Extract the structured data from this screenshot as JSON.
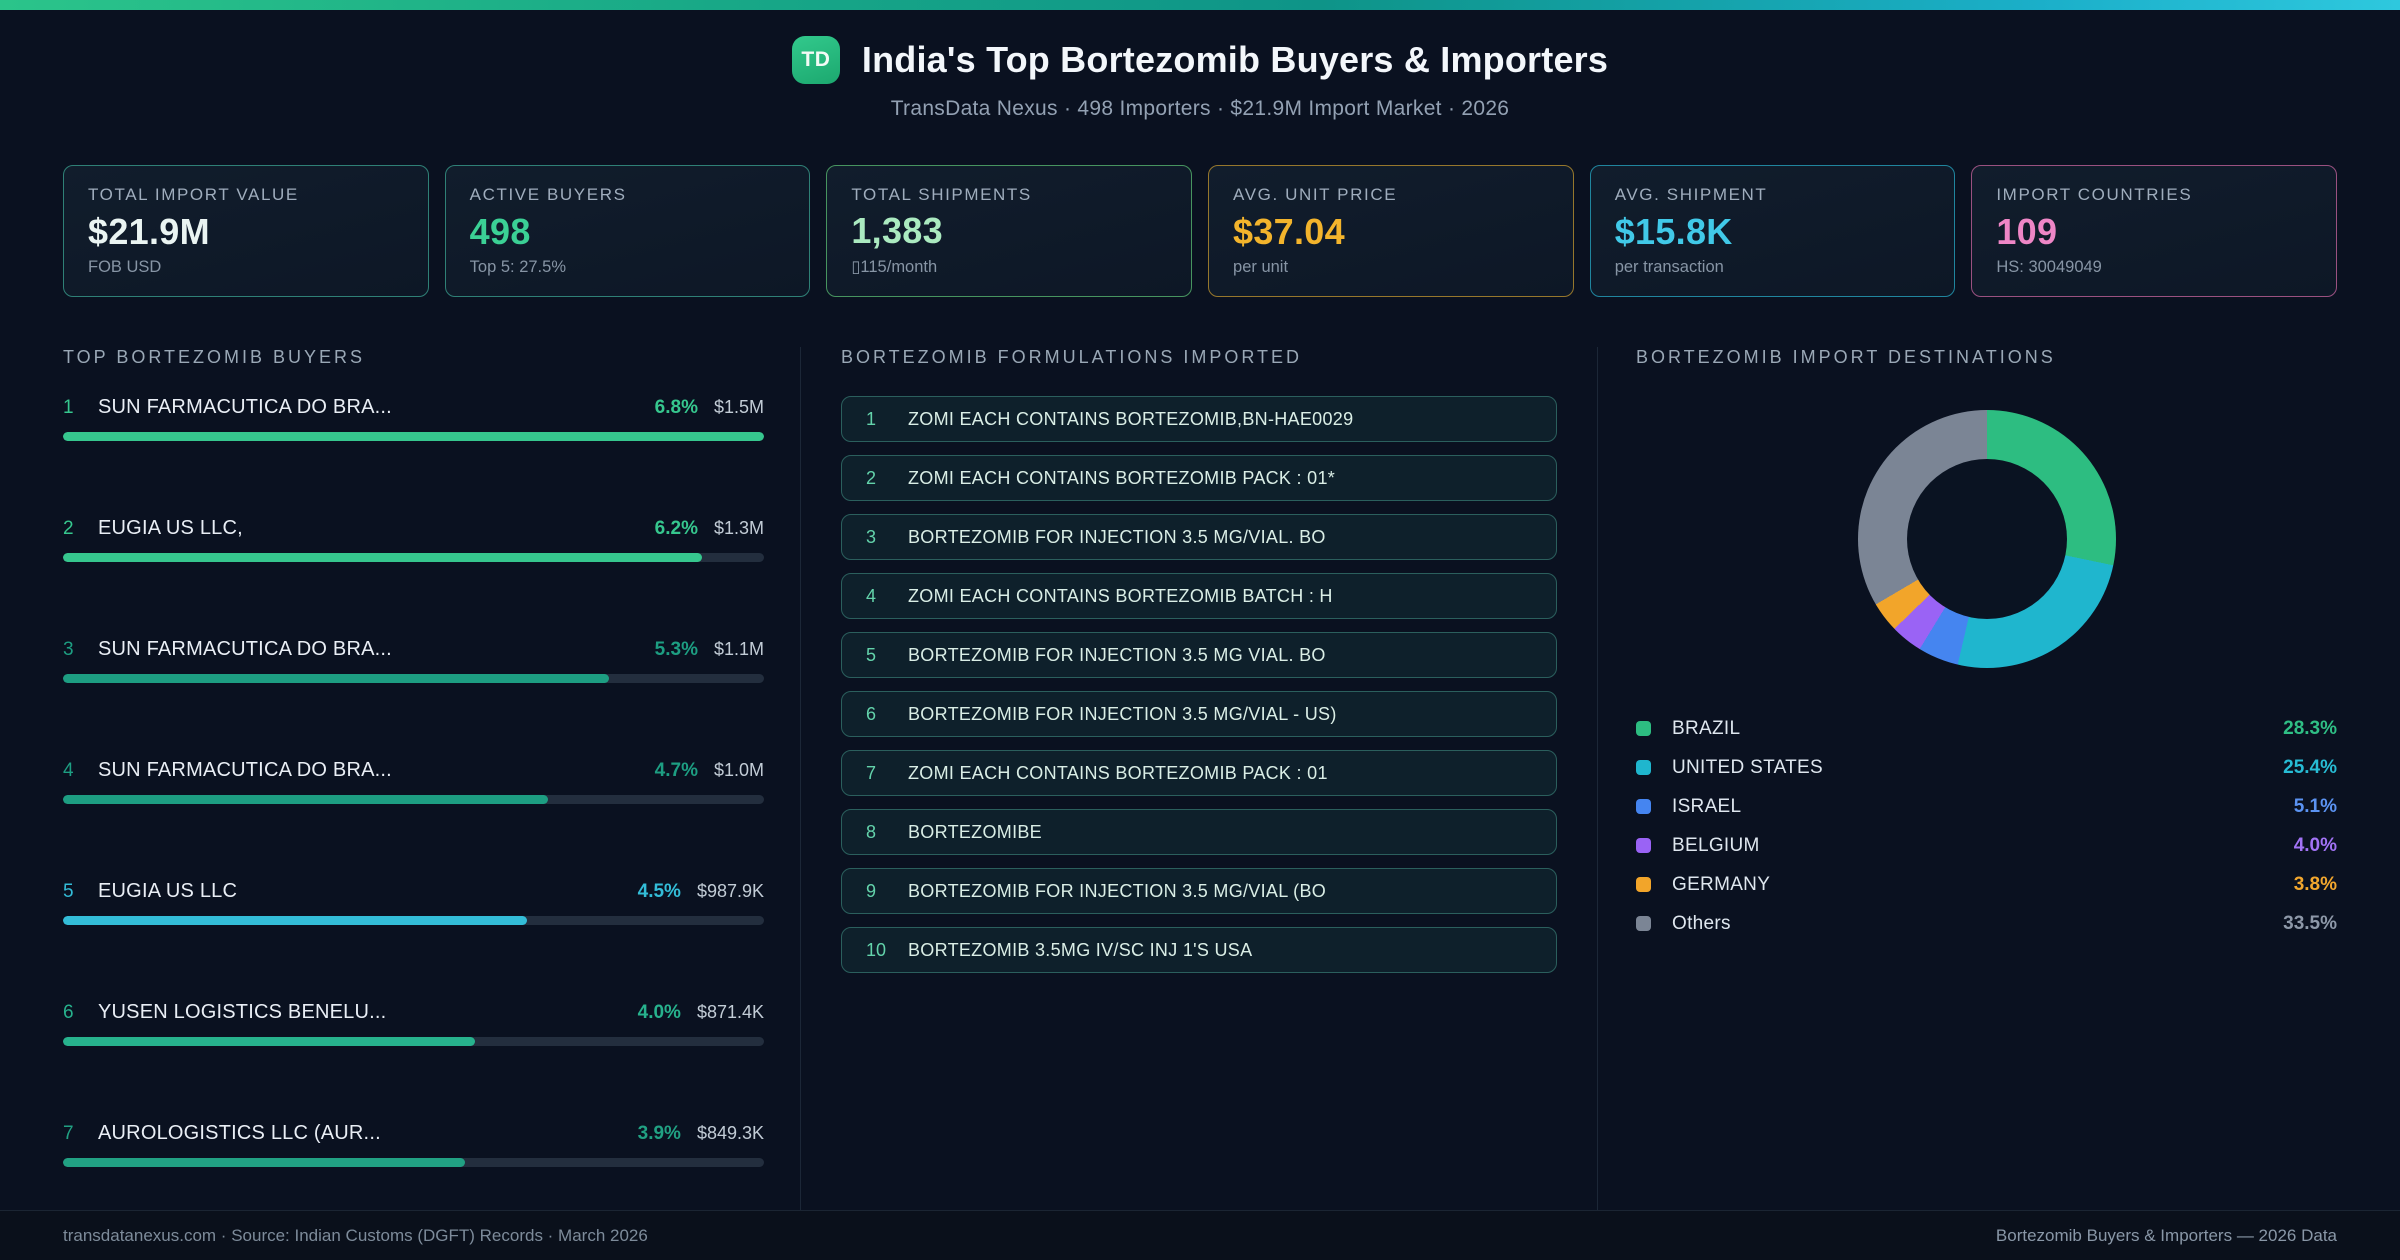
{
  "header": {
    "logo": "TD",
    "title": "India's Top Bortezomib Buyers & Importers",
    "subtitle": "TransData Nexus · 498 Importers · $21.9M Import Market · 2026"
  },
  "stats": [
    {
      "label": "TOTAL IMPORT VALUE",
      "value": "$21.9M",
      "sub": "FOB USD",
      "accent": "#2f8076",
      "value_color": "#eaf4f2"
    },
    {
      "label": "ACTIVE BUYERS",
      "value": "498",
      "sub": "Top 5: 27.5%",
      "accent": "#2f8076",
      "value_color": "#3bd095"
    },
    {
      "label": "TOTAL SHIPMENTS",
      "value": "1,383",
      "sub": "▯115/month",
      "accent": "#47945f",
      "value_color": "#abeac0"
    },
    {
      "label": "AVG. UNIT PRICE",
      "value": "$37.04",
      "sub": "per unit",
      "accent": "#96772c",
      "value_color": "#f3b42c"
    },
    {
      "label": "AVG. SHIPMENT",
      "value": "$15.8K",
      "sub": "per transaction",
      "accent": "#20859e",
      "value_color": "#41c9e8"
    },
    {
      "label": "IMPORT COUNTRIES",
      "value": "109",
      "sub": "HS: 30049049",
      "accent": "#9a5180",
      "value_color": "#ee86c6"
    }
  ],
  "buyers": {
    "heading": "TOP BORTEZOMIB BUYERS",
    "items": [
      {
        "rank": "1",
        "name": "SUN FARMACUTICA DO BRA...",
        "pct": "6.8%",
        "pct_num": 6.8,
        "value": "$1.5M",
        "color": "#36c78e"
      },
      {
        "rank": "2",
        "name": "EUGIA US LLC,",
        "pct": "6.2%",
        "pct_num": 6.2,
        "value": "$1.3M",
        "color": "#36c78e"
      },
      {
        "rank": "3",
        "name": "SUN FARMACUTICA DO BRA...",
        "pct": "5.3%",
        "pct_num": 5.3,
        "value": "$1.1M",
        "color": "#1d9e82"
      },
      {
        "rank": "4",
        "name": "SUN FARMACUTICA DO BRA...",
        "pct": "4.7%",
        "pct_num": 4.7,
        "value": "$1.0M",
        "color": "#1d9e82"
      },
      {
        "rank": "5",
        "name": "EUGIA US LLC",
        "pct": "4.5%",
        "pct_num": 4.5,
        "value": "$987.9K",
        "color": "#33bdd8"
      },
      {
        "rank": "6",
        "name": "YUSEN LOGISTICS BENELU...",
        "pct": "4.0%",
        "pct_num": 4.0,
        "value": "$871.4K",
        "color": "#27b28d"
      },
      {
        "rank": "7",
        "name": "AUROLOGISTICS LLC (AUR...",
        "pct": "3.9%",
        "pct_num": 3.9,
        "value": "$849.3K",
        "color": "#21a183"
      }
    ]
  },
  "formulations": {
    "heading": "BORTEZOMIB FORMULATIONS IMPORTED",
    "items": [
      {
        "rank": "1",
        "text": "ZOMI EACH CONTAINS BORTEZOMIB,BN-HAE0029"
      },
      {
        "rank": "2",
        "text": "ZOMI EACH CONTAINS BORTEZOMIB PACK : 01*"
      },
      {
        "rank": "3",
        "text": "BORTEZOMIB FOR INJECTION 3.5 MG/VIAL. BO"
      },
      {
        "rank": "4",
        "text": "ZOMI EACH CONTAINS BORTEZOMIB BATCH : H"
      },
      {
        "rank": "5",
        "text": "BORTEZOMIB FOR INJECTION 3.5 MG VIAL. BO"
      },
      {
        "rank": "6",
        "text": "BORTEZOMIB FOR INJECTION 3.5 MG/VIAL - US)"
      },
      {
        "rank": "7",
        "text": "ZOMI EACH CONTAINS BORTEZOMIB PACK : 01"
      },
      {
        "rank": "8",
        "text": "BORTEZOMIBE"
      },
      {
        "rank": "9",
        "text": "BORTEZOMIB FOR INJECTION 3.5 MG/VIAL (BO"
      },
      {
        "rank": "10",
        "text": "BORTEZOMIB 3.5MG IV/SC INJ 1'S USA"
      }
    ]
  },
  "destinations": {
    "heading": "BORTEZOMIB IMPORT DESTINATIONS",
    "hole_color": "#0a1322",
    "legend": [
      {
        "label": "BRAZIL",
        "pct": "28.3%",
        "pct_num": 28.3,
        "color": "#2dbd81",
        "pct_color": "#2fbf85"
      },
      {
        "label": "UNITED STATES",
        "pct": "25.4%",
        "pct_num": 25.4,
        "color": "#1fb6ce",
        "pct_color": "#27bcd4"
      },
      {
        "label": "ISRAEL",
        "pct": "5.1%",
        "pct_num": 5.1,
        "color": "#4585f0",
        "pct_color": "#5b93f2"
      },
      {
        "label": "BELGIUM",
        "pct": "4.0%",
        "pct_num": 4.0,
        "color": "#9a63f5",
        "pct_color": "#a273f5"
      },
      {
        "label": "GERMANY",
        "pct": "3.8%",
        "pct_num": 3.8,
        "color": "#f2a52a",
        "pct_color": "#f2a72e"
      },
      {
        "label": "Others",
        "pct": "33.5%",
        "pct_num": 33.5,
        "color": "#7b8595",
        "pct_color": "#8d98a8"
      }
    ]
  },
  "chart_data": [
    {
      "type": "pie",
      "title": "BORTEZOMIB IMPORT DESTINATIONS",
      "labels": [
        "BRAZIL",
        "UNITED STATES",
        "ISRAEL",
        "BELGIUM",
        "GERMANY",
        "Others"
      ],
      "values": [
        28.3,
        25.4,
        5.1,
        4.0,
        3.8,
        33.5
      ],
      "unit": "%",
      "colors": [
        "#2dbd81",
        "#1fb6ce",
        "#4585f0",
        "#9a63f5",
        "#f2a52a",
        "#7b8595"
      ],
      "donut": true,
      "legend_position": "bottom"
    },
    {
      "type": "bar",
      "title": "TOP BORTEZOMIB BUYERS",
      "orientation": "horizontal",
      "categories": [
        "SUN FARMACUTICA DO BRA...",
        "EUGIA US LLC,",
        "SUN FARMACUTICA DO BRA...",
        "SUN FARMACUTICA DO BRA...",
        "EUGIA US LLC",
        "YUSEN LOGISTICS BENELU...",
        "AUROLOGISTICS LLC (AUR..."
      ],
      "values": [
        6.8,
        6.2,
        5.3,
        4.7,
        4.5,
        4.0,
        3.9
      ],
      "value_labels": [
        "$1.5M",
        "$1.3M",
        "$1.1M",
        "$1.0M",
        "$987.9K",
        "$871.4K",
        "$849.3K"
      ],
      "unit": "% of import market",
      "xlim": [
        0,
        6.8
      ]
    }
  ],
  "footer": {
    "left": "transdatanexus.com · Source: Indian Customs (DGFT) Records · March 2026",
    "right": "Bortezomib Buyers & Importers — 2026 Data"
  }
}
